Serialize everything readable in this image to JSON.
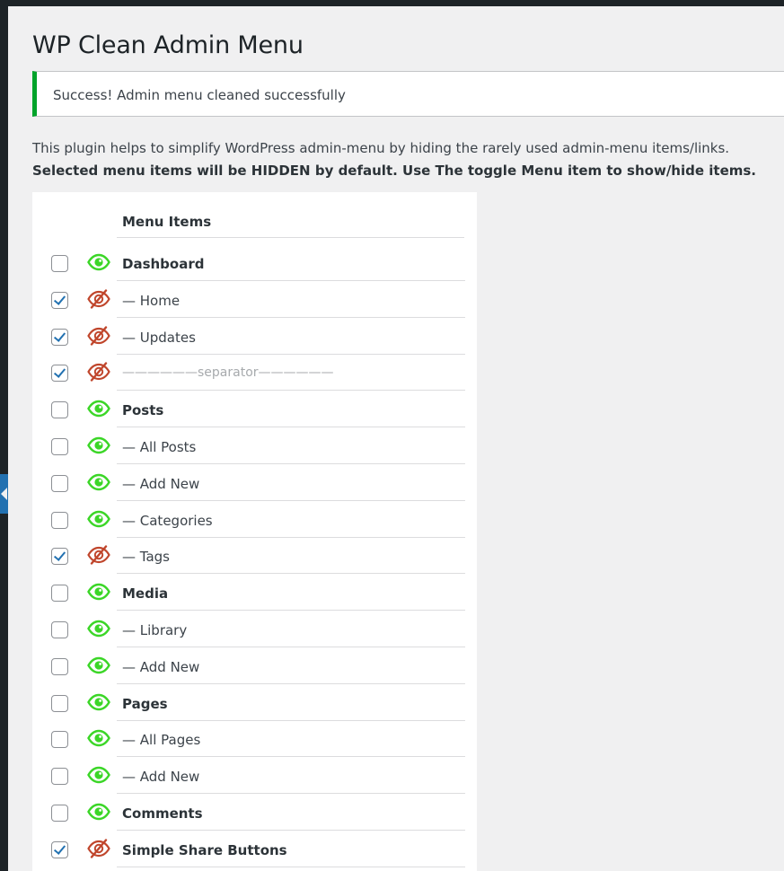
{
  "page": {
    "title": "WP Clean Admin Menu",
    "notice": "Success! Admin menu cleaned successfully",
    "description_line1": "This plugin helps to simplify WordPress admin-menu by hiding the rarely used admin-menu items/links.",
    "description_line2": "Selected menu items will be HIDDEN by default. Use The toggle Menu item to show/hide items."
  },
  "table": {
    "header": "Menu Items",
    "rows": [
      {
        "label": "Dashboard",
        "top": true,
        "checked": false,
        "icon": "eye-icon"
      },
      {
        "label": "— Home",
        "top": false,
        "checked": true,
        "icon": "eye-slash-icon"
      },
      {
        "label": "— Updates",
        "top": false,
        "checked": true,
        "icon": "eye-slash-icon"
      },
      {
        "label": "——————separator——————",
        "top": false,
        "sep": true,
        "checked": true,
        "icon": "eye-slash-icon"
      },
      {
        "label": "Posts",
        "top": true,
        "checked": false,
        "icon": "eye-icon"
      },
      {
        "label": "— All Posts",
        "top": false,
        "checked": false,
        "icon": "eye-icon"
      },
      {
        "label": "— Add New",
        "top": false,
        "checked": false,
        "icon": "eye-icon"
      },
      {
        "label": "— Categories",
        "top": false,
        "checked": false,
        "icon": "eye-icon"
      },
      {
        "label": "— Tags",
        "top": false,
        "checked": true,
        "icon": "eye-slash-icon"
      },
      {
        "label": "Media",
        "top": true,
        "checked": false,
        "icon": "eye-icon"
      },
      {
        "label": "— Library",
        "top": false,
        "checked": false,
        "icon": "eye-icon"
      },
      {
        "label": "— Add New",
        "top": false,
        "checked": false,
        "icon": "eye-icon"
      },
      {
        "label": "Pages",
        "top": true,
        "checked": false,
        "icon": "eye-icon"
      },
      {
        "label": "— All Pages",
        "top": false,
        "checked": false,
        "icon": "eye-icon"
      },
      {
        "label": "— Add New",
        "top": false,
        "checked": false,
        "icon": "eye-icon"
      },
      {
        "label": "Comments",
        "top": true,
        "checked": false,
        "icon": "eye-icon"
      },
      {
        "label": "Simple Share Buttons",
        "top": true,
        "checked": true,
        "icon": "eye-slash-icon"
      }
    ]
  },
  "colors": {
    "visible_eye": "#3bd627",
    "hidden_eye": "#c0462c",
    "notice_border": "#00a32a",
    "checkbox_check": "#2271b1"
  }
}
